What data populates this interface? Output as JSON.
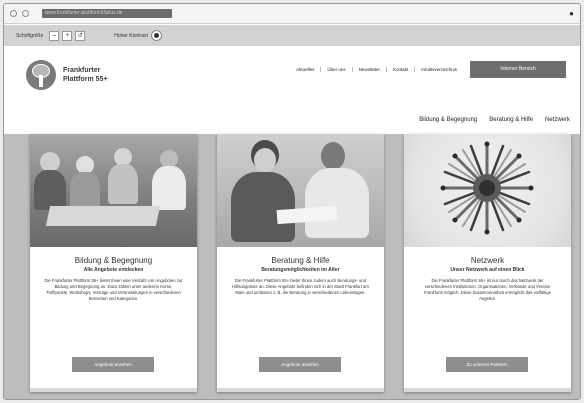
{
  "browser": {
    "url": "www.frankfurter-plattform55plus.de",
    "menu_icon": "kebab-menu-icon"
  },
  "accessibility": {
    "font_size_label": "Schriftgröße",
    "font_buttons": [
      "–",
      "+",
      "↺"
    ],
    "contrast_label": "Hoher Kontrast"
  },
  "header": {
    "logo_line1": "Frankfurter",
    "logo_line2": "Plattform 55+",
    "topnav": [
      "Aktuelles",
      "Über uns",
      "Newsletter",
      "Kontakt",
      "Inhaltsverzeichnis"
    ],
    "cta_label": "Interner Bereich"
  },
  "mainnav": [
    "Bildung & Begegnung",
    "Beratung & Hilfe",
    "Netzwerk"
  ],
  "cards": [
    {
      "title": "Bildung & Begegnung",
      "subtitle": "Alle Angebote entdecken",
      "desc": "Die Frankfurter Plattform 55+ bietet Ihnen eine Vielzahl von Angeboten zur Bildung und Begegnung an. Dazu zählen unter anderem Kurse, Treffpunkte, Workshops, Vorträge und Veranstaltungen in verschiedenen Bereichen und Kategorien.",
      "button": "Angebote ansehen"
    },
    {
      "title": "Beratung & Hilfe",
      "subtitle": "Beratungsmöglichkeiten im Alter",
      "desc": "Die Frankfurter Plattform 55+ bietet Ihnen zudem auch Beratungs- und Hilfsangebote an. Diese Angebote befinden sich in der Stadt Frankfurt am Main und umfassen z. B. die Beratung in verschiedenen Lebenslagen.",
      "button": "Angebote ansehen"
    },
    {
      "title": "Netzwerk",
      "subtitle": "Unser Netzwerk auf einen Blick",
      "desc": "Die Frankfurter Plattform 55+ ist nur durch das Netzwerk der verschiedenen Institutionen, Organisationen, Verbände und Vereine Frankfurts möglich. Diese Zusammenarbeit ermöglicht das vielfältige Angebot.",
      "button": "Zu unseren Partnern"
    }
  ]
}
